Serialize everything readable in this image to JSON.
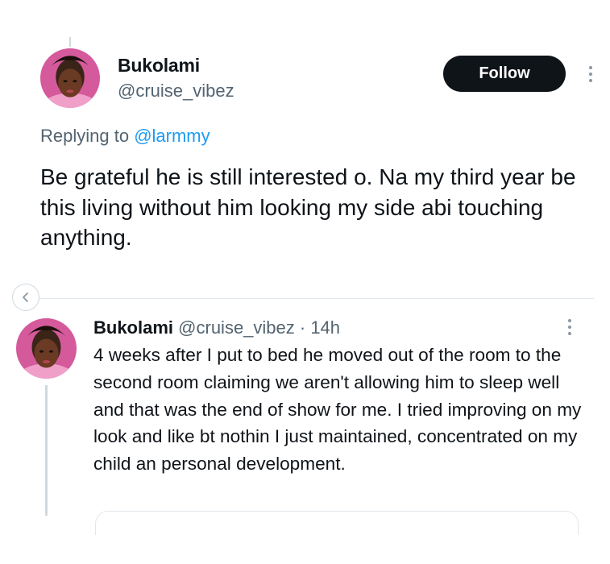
{
  "main_tweet": {
    "display_name": "Bukolami",
    "handle": "@cruise_vibez",
    "follow_label": "Follow",
    "replying_prefix": "Replying to",
    "replying_handle": "@larmmy",
    "text": "Be grateful he is still interested o. Na my third year be this living without him looking my side abi touching anything."
  },
  "reply_tweet": {
    "display_name": "Bukolami",
    "meta": "@cruise_vibez · 14h",
    "text": "4 weeks after I put to bed he moved out of the room to the second room claiming we aren't allowing him to sleep well and that was the end of show for me. I tried improving on my look and like bt nothin I just maintained, concentrated on my child an personal development."
  },
  "icons": {
    "more": "more-vertical-icon",
    "back": "chevron-left-icon"
  },
  "colors": {
    "link": "#1d9bf0",
    "secondary_text": "#536471",
    "primary_text": "#0f1419",
    "follow_bg": "#0f1419"
  }
}
